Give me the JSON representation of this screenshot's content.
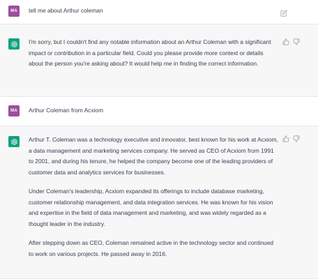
{
  "messages": [
    {
      "role": "user",
      "avatar": "MA",
      "text": "tell me about Arthur coleman",
      "icons": [
        "edit-icon"
      ]
    },
    {
      "role": "assistant",
      "avatar_icon": "openai-logo-icon",
      "paragraphs": [
        "I'm sorry, but I couldn't find any notable information about an Arthur Coleman with a significant impact or contribution in a particular field. Could you please provide more context or details about the person you're asking about? It would help me in finding the correct information."
      ],
      "icons": [
        "thumbs-up-icon",
        "thumbs-down-icon"
      ]
    },
    {
      "role": "user",
      "avatar": "MA",
      "text": "Arthur Coleman from Acxiom",
      "icons": []
    },
    {
      "role": "assistant",
      "avatar_icon": "openai-logo-icon",
      "paragraphs": [
        "Arthur T. Coleman was a technology executive and innovator, best known for his work at Acxiom, a data management and marketing services company. He served as CEO of Acxiom from 1991 to 2001, and during his tenure, he helped the company become one of the leading providers of customer data and analytics services for businesses.",
        "Under Coleman's leadership, Acxiom expanded its offerings to include database marketing, customer relationship management, and data integration services. He was known for his vision and expertise in the field of data management and marketing, and was widely regarded as a thought leader in the industry.",
        "After stepping down as CEO, Coleman remained active in the technology sector and continued to work on various projects. He passed away in 2016."
      ],
      "icons": [
        "thumbs-up-icon",
        "thumbs-down-icon"
      ]
    }
  ],
  "colors": {
    "user_avatar": "#9c4f9e",
    "assistant_avatar": "#10a37f",
    "assistant_bg": "#f7f7f8"
  }
}
